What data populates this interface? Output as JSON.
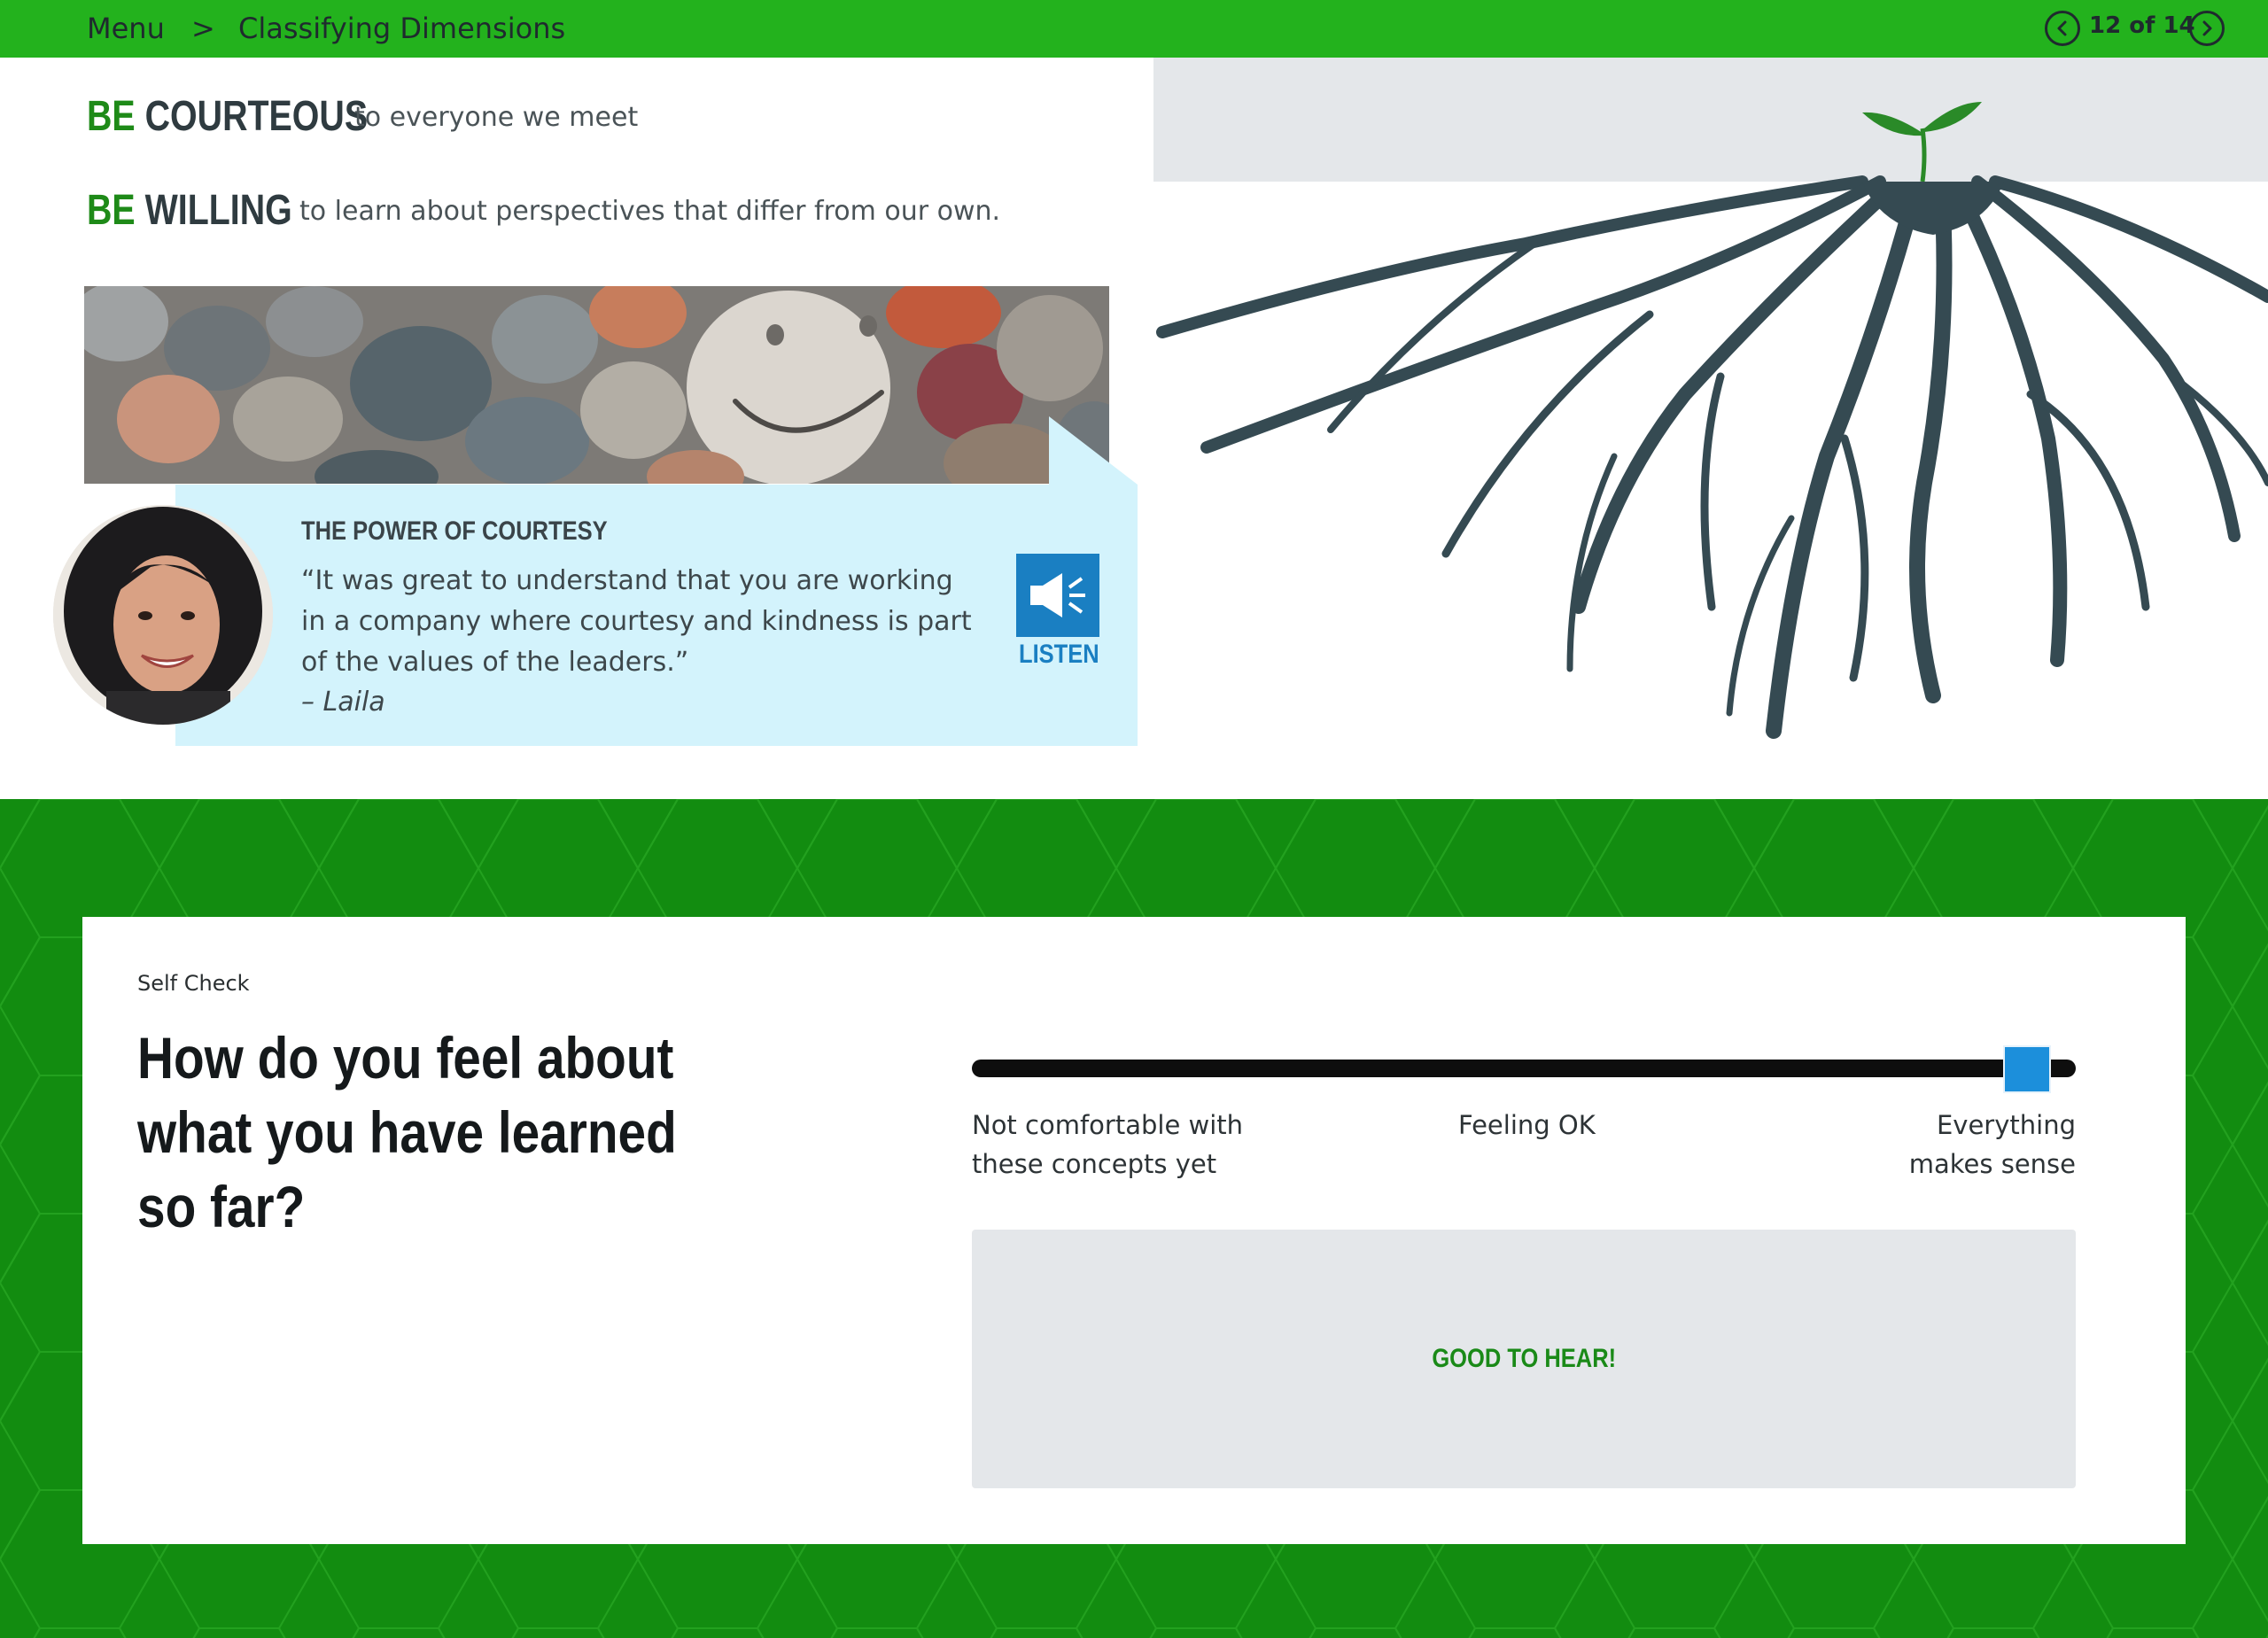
{
  "header": {
    "menu_label": "Menu",
    "separator": ">",
    "page_title": "Classifying Dimensions",
    "pager_text": "12 of 14"
  },
  "principles": [
    {
      "be": "BE",
      "keyword": "COURTEOUS",
      "description": "to everyone we meet"
    },
    {
      "be": "BE",
      "keyword": "WILLING",
      "description": "to learn about perspectives that differ from our own."
    }
  ],
  "quote": {
    "title": "THE POWER OF COURTESY",
    "text": "“It was great to understand that you are working in a company where courtesy and kindness is part of the values of the leaders.”",
    "author": "– Laila",
    "listen_label": "LISTEN"
  },
  "self_check": {
    "label": "Self Check",
    "question": "How do you feel about what you have learned so far?",
    "slider": {
      "value": 1.0,
      "left_label": "Not comfortable with these concepts yet",
      "middle_label": "Feeling OK",
      "right_label": "Everything makes sense"
    },
    "feedback": "GOOD TO HEAR!"
  },
  "colors": {
    "topbar": "#23b21d",
    "accent_green": "#1e8a18",
    "section_green": "#128c10",
    "listen_blue": "#1a7fc2",
    "quote_bg": "#d3f3fc",
    "roots": "#354a52"
  },
  "icons": [
    "chevron-left-icon",
    "chevron-right-icon",
    "speaker-icon",
    "seedling-icon"
  ]
}
